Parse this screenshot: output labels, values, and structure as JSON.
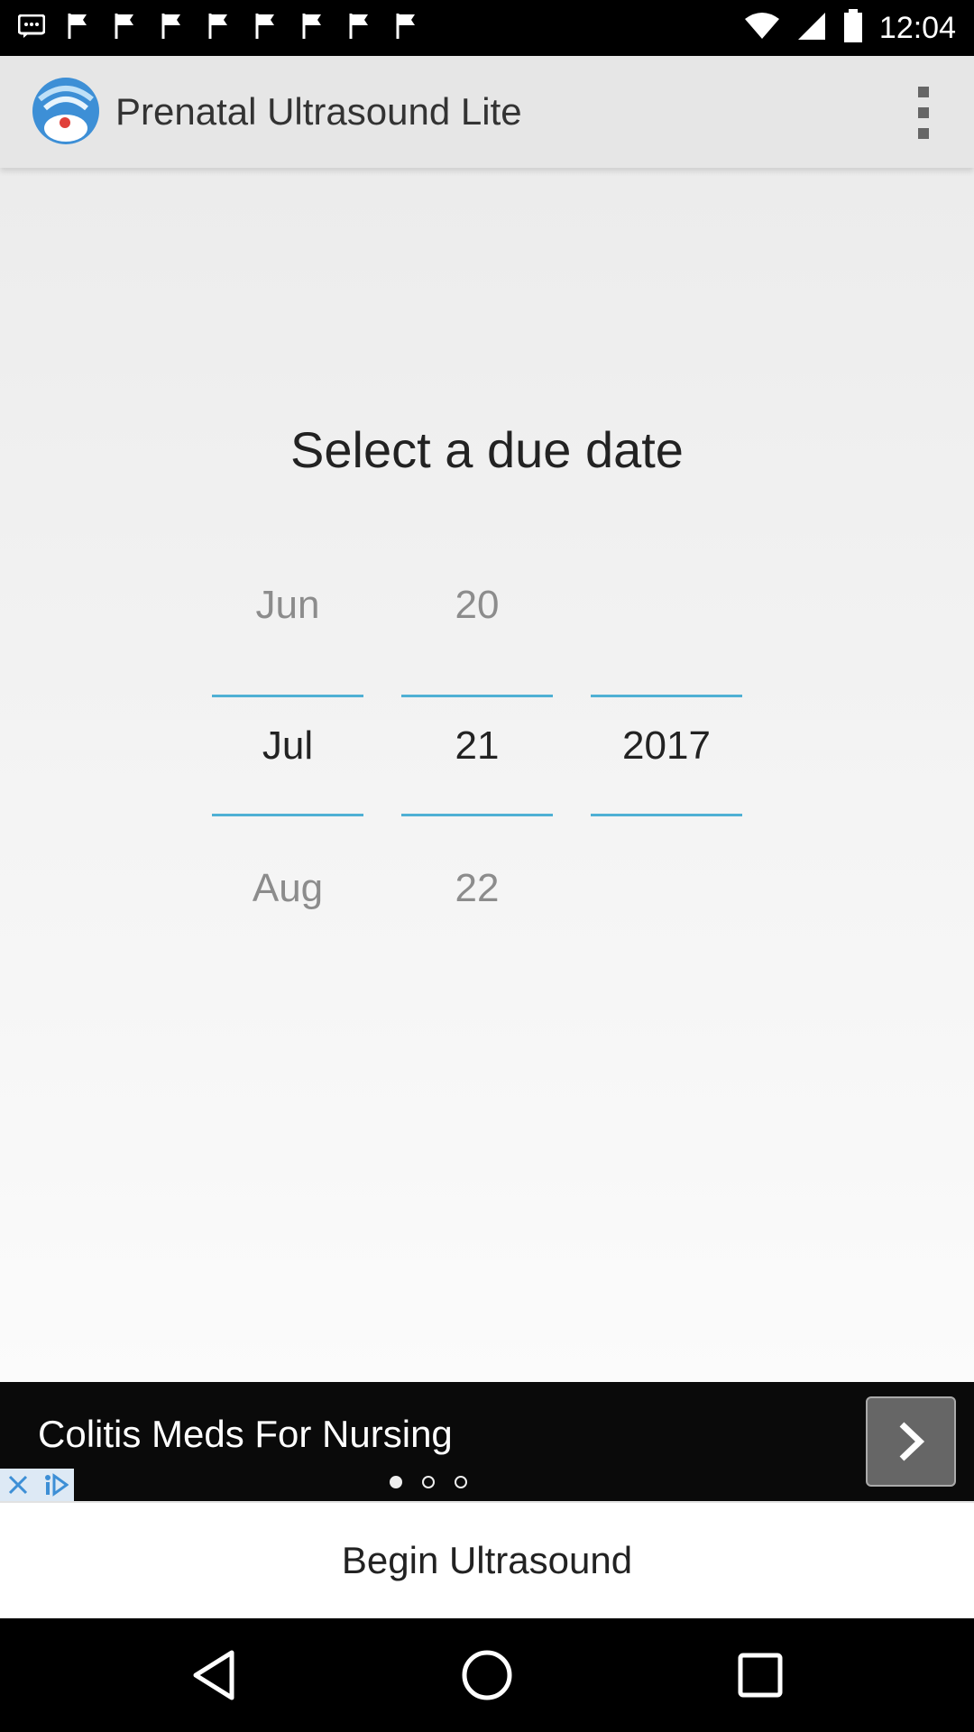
{
  "status_bar": {
    "time": "12:04",
    "notification_icons": [
      "message-icon",
      "flag-icon",
      "flag-icon",
      "flag-icon",
      "flag-icon",
      "flag-icon",
      "flag-icon",
      "flag-icon",
      "flag-icon"
    ],
    "wifi_icon": "wifi-icon",
    "signal_icon": "signal-icon",
    "battery_icon": "battery-icon"
  },
  "app_bar": {
    "title": "Prenatal Ultrasound Lite",
    "logo_icon": "ultrasound-logo-icon",
    "menu_icon": "overflow-menu-icon"
  },
  "main": {
    "heading": "Select a due date",
    "picker": {
      "month": {
        "prev": "Jun",
        "selected": "Jul",
        "next": "Aug"
      },
      "day": {
        "prev": "20",
        "selected": "21",
        "next": "22"
      },
      "year": {
        "prev": "",
        "selected": "2017",
        "next": ""
      }
    }
  },
  "ad": {
    "text": "Colitis Meds For Nursing",
    "dots_total": 3,
    "dots_active": 1
  },
  "begin_button": {
    "label": "Begin Ultrasound"
  },
  "colors": {
    "accent_line": "#4fb0d4",
    "app_bar_bg": "#e6e6e6",
    "ad_bg": "#0a0a0a"
  }
}
